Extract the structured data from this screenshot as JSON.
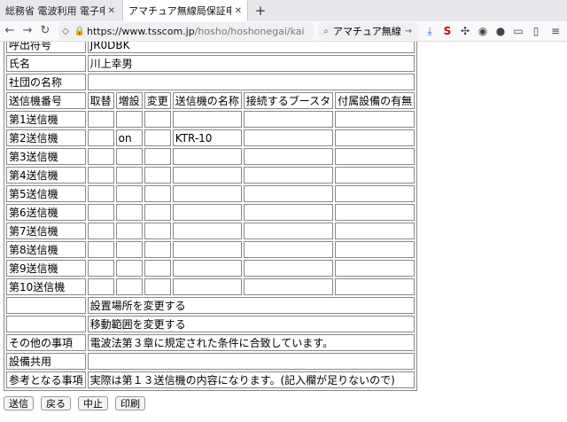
{
  "browser": {
    "tabs": [
      {
        "title": "総務省 電波利用 電子申請・届出システム"
      },
      {
        "title": "アマチュア無線局保証申込み"
      }
    ],
    "url": {
      "host": "https://www.tsscom.jp",
      "path": "/hosho/hoshonegai/kai"
    },
    "search_text": "アマチュア無線"
  },
  "form": {
    "callsign_label": "呼出符号",
    "callsign_value": "JR0DBK",
    "name_label": "氏名",
    "name_value": "川上幸男",
    "club_label": "社団の名称",
    "club_value": "",
    "headers": [
      "送信機番号",
      "取替",
      "増設",
      "変更",
      "送信機の名称",
      "接続するブースタ",
      "付属設備の有無"
    ],
    "transmitters": [
      {
        "label": "第1送信機",
        "replace": "",
        "add": "",
        "change": "",
        "name": "",
        "booster": "",
        "accessory": ""
      },
      {
        "label": "第2送信機",
        "replace": "",
        "add": "on",
        "change": "",
        "name": "KTR-10",
        "booster": "",
        "accessory": ""
      },
      {
        "label": "第3送信機",
        "replace": "",
        "add": "",
        "change": "",
        "name": "",
        "booster": "",
        "accessory": ""
      },
      {
        "label": "第4送信機",
        "replace": "",
        "add": "",
        "change": "",
        "name": "",
        "booster": "",
        "accessory": ""
      },
      {
        "label": "第5送信機",
        "replace": "",
        "add": "",
        "change": "",
        "name": "",
        "booster": "",
        "accessory": ""
      },
      {
        "label": "第6送信機",
        "replace": "",
        "add": "",
        "change": "",
        "name": "",
        "booster": "",
        "accessory": ""
      },
      {
        "label": "第7送信機",
        "replace": "",
        "add": "",
        "change": "",
        "name": "",
        "booster": "",
        "accessory": ""
      },
      {
        "label": "第8送信機",
        "replace": "",
        "add": "",
        "change": "",
        "name": "",
        "booster": "",
        "accessory": ""
      },
      {
        "label": "第9送信機",
        "replace": "",
        "add": "",
        "change": "",
        "name": "",
        "booster": "",
        "accessory": ""
      },
      {
        "label": "第10送信機",
        "replace": "",
        "add": "",
        "change": "",
        "name": "",
        "booster": "",
        "accessory": ""
      }
    ],
    "location_change": "設置場所を変更する",
    "range_change": "移動範囲を変更する",
    "other_label": "その他の事項",
    "other_value": "電波法第３章に規定された条件に合致しています。",
    "shared_label": "設備共用",
    "shared_value": "",
    "reference_label": "参考となる事項",
    "reference_value": "実際は第１３送信機の内容になります。(記入欄が足りないので)"
  },
  "buttons": {
    "submit": "送信",
    "back": "戻る",
    "cancel": "中止",
    "print": "印刷"
  }
}
